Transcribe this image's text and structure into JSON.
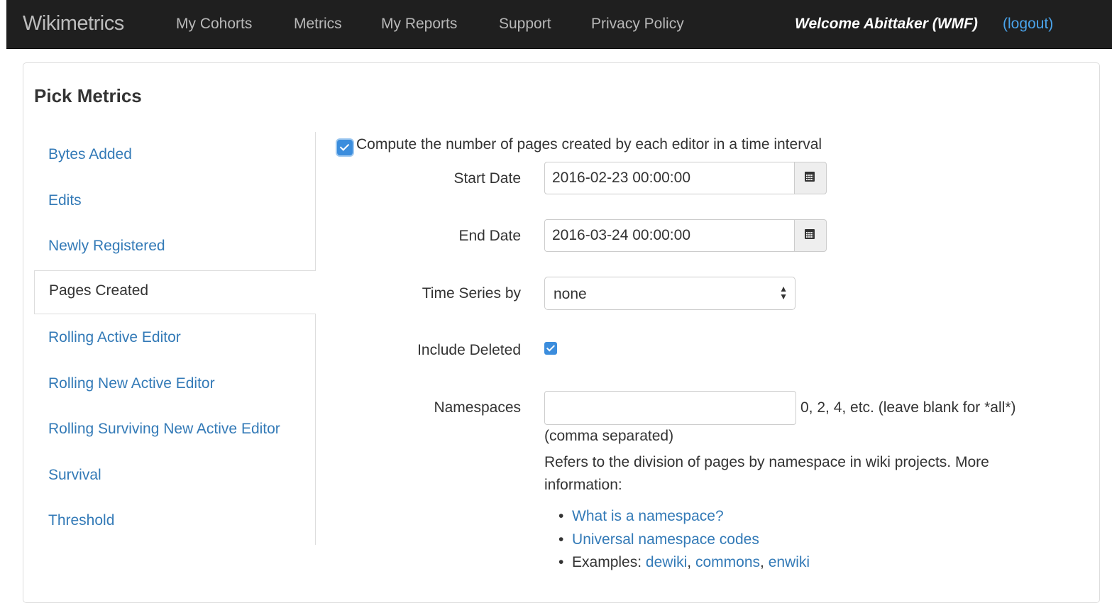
{
  "app": {
    "brand": "Wikimetrics"
  },
  "nav": {
    "items": [
      {
        "label": "My Cohorts"
      },
      {
        "label": "Metrics"
      },
      {
        "label": "My Reports"
      },
      {
        "label": "Support"
      },
      {
        "label": "Privacy Policy"
      }
    ],
    "welcome": "Welcome Abittaker (WMF)",
    "logout": "(logout)"
  },
  "page": {
    "title": "Pick Metrics"
  },
  "sidebar": {
    "items": [
      {
        "label": "Bytes Added"
      },
      {
        "label": "Edits"
      },
      {
        "label": "Newly Registered"
      },
      {
        "label": "Pages Created",
        "active": true
      },
      {
        "label": "Rolling Active Editor"
      },
      {
        "label": "Rolling New Active Editor"
      },
      {
        "label": "Rolling Surviving New Active Editor"
      },
      {
        "label": "Survival"
      },
      {
        "label": "Threshold"
      }
    ]
  },
  "form": {
    "description": "Compute the number of pages created by each editor in a time interval",
    "description_checked": true,
    "start_date": {
      "label": "Start Date",
      "value": "2016-02-23 00:00:00"
    },
    "end_date": {
      "label": "End Date",
      "value": "2016-03-24 00:00:00"
    },
    "time_series": {
      "label": "Time Series by",
      "value": "none"
    },
    "include_deleted": {
      "label": "Include Deleted",
      "checked": true
    },
    "namespaces": {
      "label": "Namespaces",
      "value": "",
      "hint": "0, 2, 4, etc. (leave blank for *all*)",
      "sub": "(comma separated)",
      "help": "Refers to the division of pages by namespace in wiki projects. More information:",
      "links": [
        "What is a namespace?",
        "Universal namespace codes"
      ],
      "examples_label": "Examples:",
      "examples": [
        "dewiki",
        "commons",
        "enwiki"
      ],
      "sep": ","
    }
  },
  "colors": {
    "topbar": "#1f1f1f",
    "link": "#337ab7",
    "accent": "#3b8ddd"
  }
}
